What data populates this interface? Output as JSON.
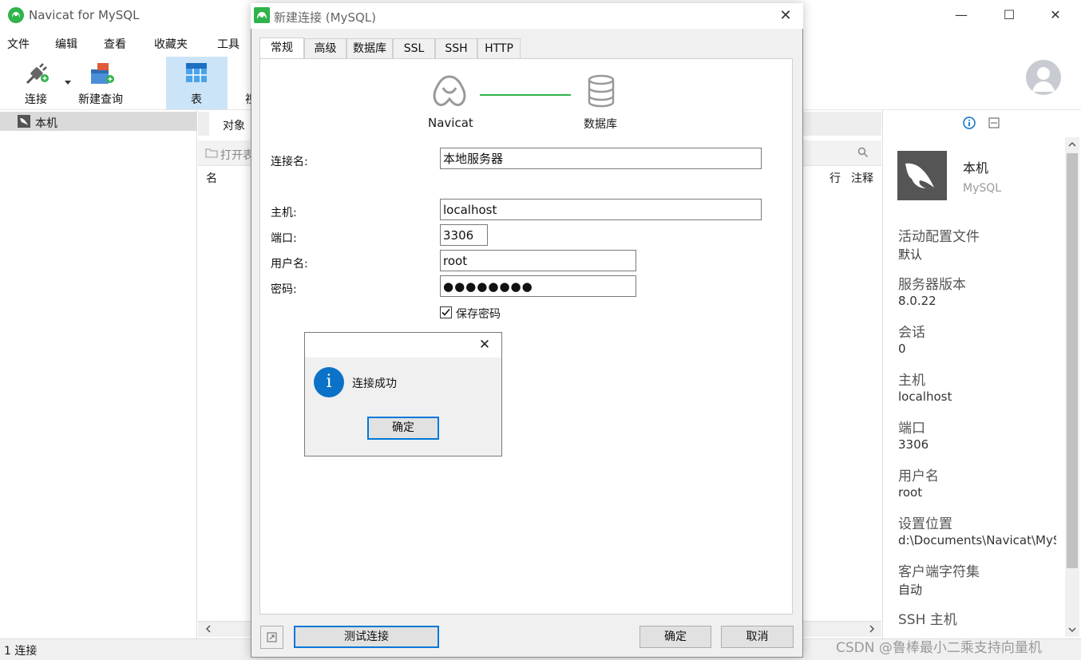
{
  "app": {
    "title": "Navicat for MySQL",
    "accent": "#2fb34a",
    "window_controls": [
      "—",
      "☐",
      "✕"
    ]
  },
  "menu": [
    "文件",
    "编辑",
    "查看",
    "收藏夹",
    "工具"
  ],
  "toolbar": {
    "connect_label": "连接",
    "new_query_label": "新建查询",
    "table_label": "表",
    "view_label_partial": "视"
  },
  "sidebar": {
    "items": [
      {
        "label": "本机",
        "icon": "mysql-connection-icon"
      }
    ]
  },
  "center": {
    "tab_objects": "对象",
    "open_table_partial": "打开表",
    "col_name": "名",
    "col_rows": "行",
    "col_comment": "注释"
  },
  "info": {
    "name": "本机",
    "type": "MySQL",
    "fields": [
      {
        "label": "活动配置文件",
        "value": "默认"
      },
      {
        "label": "服务器版本",
        "value": "8.0.22"
      },
      {
        "label": "会话",
        "value": "0"
      },
      {
        "label": "主机",
        "value": "localhost"
      },
      {
        "label": "端口",
        "value": "3306"
      },
      {
        "label": "用户名",
        "value": "root"
      },
      {
        "label": "设置位置",
        "value": "d:\\Documents\\Navicat\\MySQL"
      },
      {
        "label": "客户端字符集",
        "value": "自动"
      },
      {
        "label": "SSH 主机",
        "value": ""
      }
    ]
  },
  "status": {
    "left": "1 连接",
    "watermark": "CSDN @鲁棒最小二乘支持向量机"
  },
  "dialog": {
    "title": "新建连接 (MySQL)",
    "tabs": [
      "常规",
      "高级",
      "数据库",
      "SSL",
      "SSH",
      "HTTP"
    ],
    "active_tab": "常规",
    "diagram_left": "Navicat",
    "diagram_right": "数据库",
    "fields": {
      "conn_name_label": "连接名:",
      "conn_name_value": "本地服务器",
      "host_label": "主机:",
      "host_value": "localhost",
      "port_label": "端口:",
      "port_value": "3306",
      "user_label": "用户名:",
      "user_value": "root",
      "password_label": "密码:",
      "password_value": "●●●●●●●●",
      "save_password_label": "保存密码",
      "save_password_checked": true
    },
    "buttons": {
      "test": "测试连接",
      "ok": "确定",
      "cancel": "取消"
    }
  },
  "message_box": {
    "text": "连接成功",
    "ok": "确定",
    "icon": "info-icon",
    "icon_glyph": "i",
    "close_glyph": "✕"
  }
}
